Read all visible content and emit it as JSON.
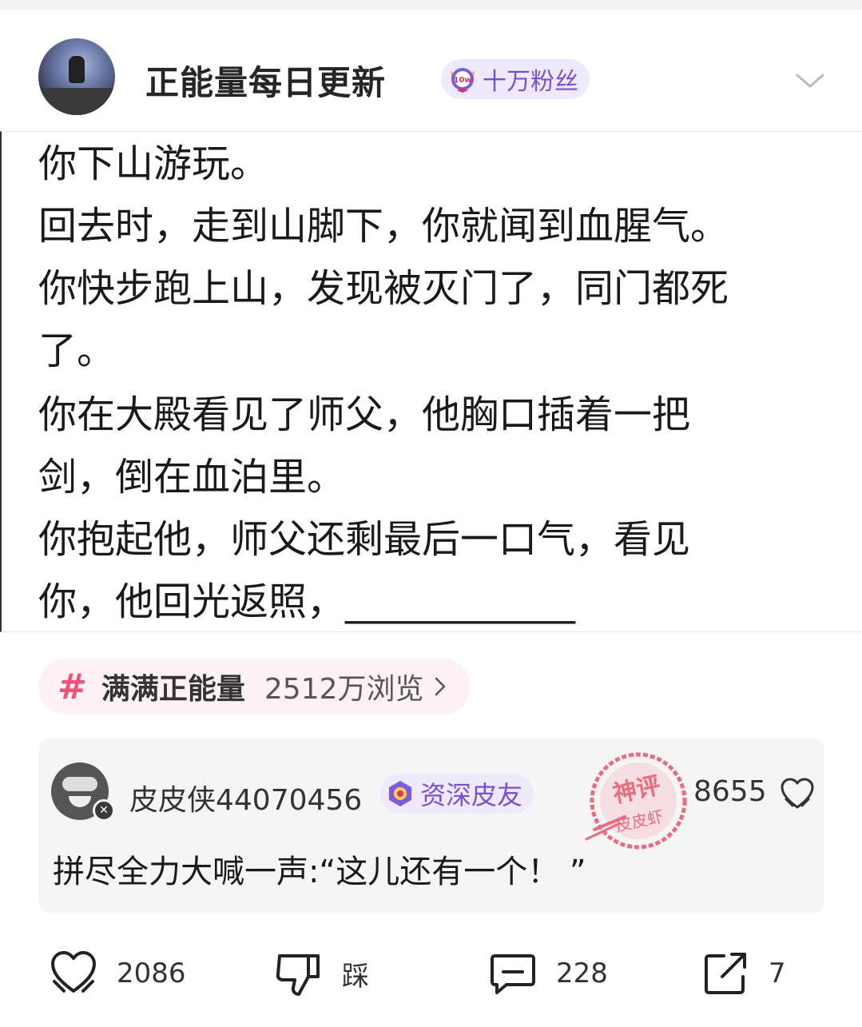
{
  "header": {
    "author_name": "正能量每日更新",
    "fan_badge": "十万粉丝",
    "fan_badge_medal_text": "10w"
  },
  "content": {
    "lines": [
      "你下山游玩。",
      "回去时，走到山脚下，你就闻到血腥气。",
      "你快步跑上山，发现被灭门了，同门都死",
      "了。",
      "你在大殿看见了师父，他胸口插着一把",
      "剑，倒在血泊里。",
      "你抱起他，师父还剩最后一口气，看见",
      "你，他回光返照，____________"
    ]
  },
  "topic": {
    "hash": "#",
    "name": "满满正能量",
    "views": "2512万浏览"
  },
  "comment": {
    "username": "皮皮侠44070456",
    "badge": "资深皮友",
    "stamp_top": "神评",
    "stamp_bottom": "皮皮虾",
    "likes": "8655",
    "text": "拼尽全力大喊一声:“这儿还有一个！ ”"
  },
  "actions": {
    "like_count": "2086",
    "dislike_label": "踩",
    "comment_count": "228",
    "share_count": "7"
  },
  "colors": {
    "badge_purple": "#7a4fd0",
    "badge_bg": "#efeafb",
    "topic_pink": "#f0537a",
    "stamp_red": "#e8566a"
  }
}
